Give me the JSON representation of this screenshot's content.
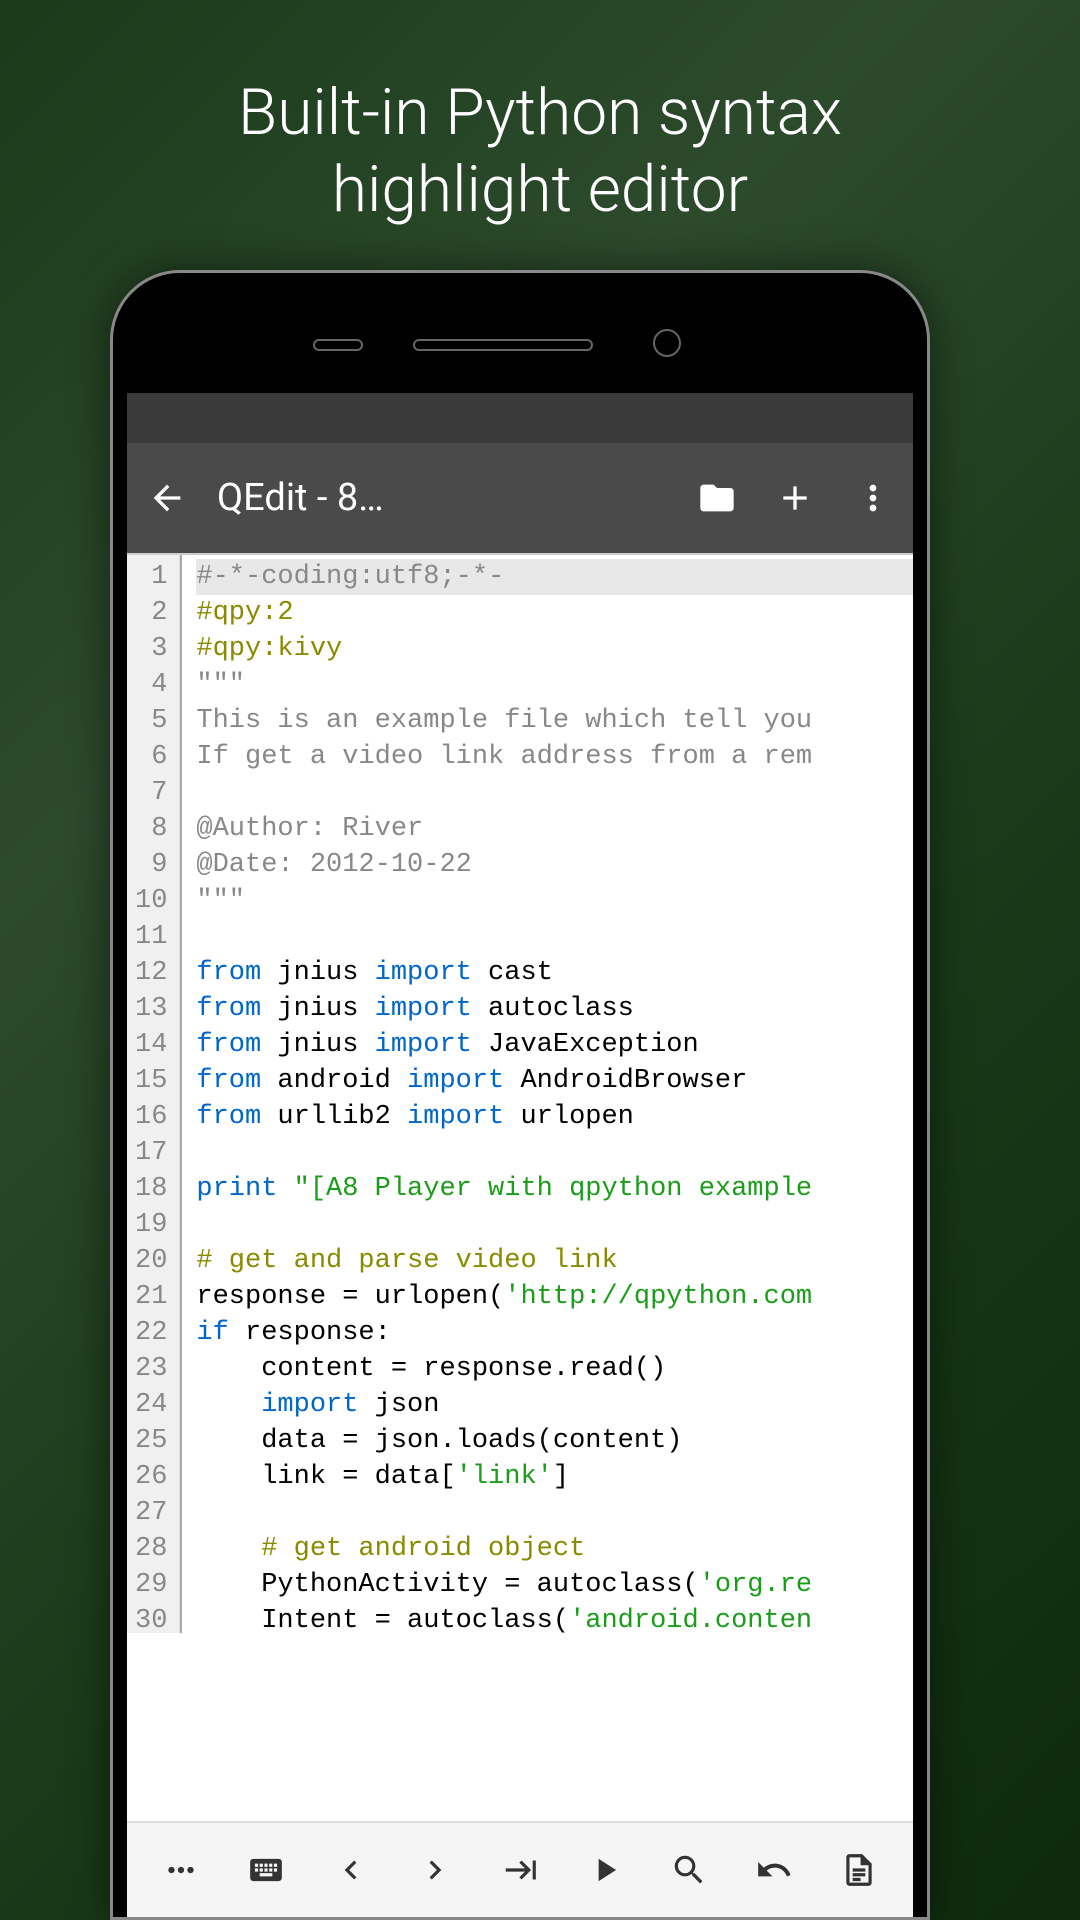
{
  "promo": {
    "line1": "Built-in Python syntax",
    "line2": "highlight editor"
  },
  "appbar": {
    "title": "QEdit - 8…"
  },
  "icons": {
    "back": "back-arrow",
    "folder": "folder",
    "add": "plus",
    "more": "more-vert",
    "menu": "dots",
    "keyboard": "keyboard",
    "left": "chevron-left",
    "right": "chevron-right",
    "tab": "tab-arrow",
    "play": "play",
    "search": "search",
    "undo": "undo",
    "doc": "document"
  },
  "code": {
    "line_count": 30,
    "lines": [
      {
        "n": 1,
        "hl": true,
        "tokens": [
          {
            "t": "#-*-coding:utf8;-*-",
            "c": "doc"
          }
        ]
      },
      {
        "n": 2,
        "tokens": [
          {
            "t": "#qpy:2",
            "c": "cmt"
          }
        ]
      },
      {
        "n": 3,
        "tokens": [
          {
            "t": "#qpy:kivy",
            "c": "cmt"
          }
        ]
      },
      {
        "n": 4,
        "tokens": [
          {
            "t": "\"\"\"",
            "c": "doc"
          }
        ]
      },
      {
        "n": 5,
        "tokens": [
          {
            "t": "This is an example file which tell you",
            "c": "doc"
          }
        ]
      },
      {
        "n": 6,
        "tokens": [
          {
            "t": "If get a video link address from a rem",
            "c": "doc"
          }
        ]
      },
      {
        "n": 7,
        "tokens": [
          {
            "t": "",
            "c": ""
          }
        ]
      },
      {
        "n": 8,
        "tokens": [
          {
            "t": "@Author: River",
            "c": "doc"
          }
        ]
      },
      {
        "n": 9,
        "tokens": [
          {
            "t": "@Date: 2012-10-22",
            "c": "doc"
          }
        ]
      },
      {
        "n": 10,
        "tokens": [
          {
            "t": "\"\"\"",
            "c": "doc"
          }
        ]
      },
      {
        "n": 11,
        "tokens": [
          {
            "t": "",
            "c": ""
          }
        ]
      },
      {
        "n": 12,
        "tokens": [
          {
            "t": "from",
            "c": "kw"
          },
          {
            "t": " jnius ",
            "c": ""
          },
          {
            "t": "import",
            "c": "kw"
          },
          {
            "t": " cast",
            "c": ""
          }
        ]
      },
      {
        "n": 13,
        "tokens": [
          {
            "t": "from",
            "c": "kw"
          },
          {
            "t": " jnius ",
            "c": ""
          },
          {
            "t": "import",
            "c": "kw"
          },
          {
            "t": " autoclass",
            "c": ""
          }
        ]
      },
      {
        "n": 14,
        "tokens": [
          {
            "t": "from",
            "c": "kw"
          },
          {
            "t": " jnius ",
            "c": ""
          },
          {
            "t": "import",
            "c": "kw"
          },
          {
            "t": " JavaException",
            "c": ""
          }
        ]
      },
      {
        "n": 15,
        "tokens": [
          {
            "t": "from",
            "c": "kw"
          },
          {
            "t": " android ",
            "c": ""
          },
          {
            "t": "import",
            "c": "kw"
          },
          {
            "t": " AndroidBrowser",
            "c": ""
          }
        ]
      },
      {
        "n": 16,
        "tokens": [
          {
            "t": "from",
            "c": "kw"
          },
          {
            "t": " urllib2 ",
            "c": ""
          },
          {
            "t": "import",
            "c": "kw"
          },
          {
            "t": " urlopen",
            "c": ""
          }
        ]
      },
      {
        "n": 17,
        "tokens": [
          {
            "t": "",
            "c": ""
          }
        ]
      },
      {
        "n": 18,
        "tokens": [
          {
            "t": "print",
            "c": "kw"
          },
          {
            "t": " ",
            "c": ""
          },
          {
            "t": "\"[A8 Player with qpython example",
            "c": "str"
          }
        ]
      },
      {
        "n": 19,
        "tokens": [
          {
            "t": "",
            "c": ""
          }
        ]
      },
      {
        "n": 20,
        "tokens": [
          {
            "t": "# get and parse video link",
            "c": "cmt"
          }
        ]
      },
      {
        "n": 21,
        "tokens": [
          {
            "t": "response = urlopen(",
            "c": ""
          },
          {
            "t": "'http://qpython.com",
            "c": "str"
          }
        ]
      },
      {
        "n": 22,
        "tokens": [
          {
            "t": "if",
            "c": "kw"
          },
          {
            "t": " response:",
            "c": ""
          }
        ]
      },
      {
        "n": 23,
        "tokens": [
          {
            "t": "    content = response.read()",
            "c": ""
          }
        ]
      },
      {
        "n": 24,
        "tokens": [
          {
            "t": "    ",
            "c": ""
          },
          {
            "t": "import",
            "c": "kw"
          },
          {
            "t": " json",
            "c": ""
          }
        ]
      },
      {
        "n": 25,
        "tokens": [
          {
            "t": "    data = json.loads(content)",
            "c": ""
          }
        ]
      },
      {
        "n": 26,
        "tokens": [
          {
            "t": "    link = data[",
            "c": ""
          },
          {
            "t": "'link'",
            "c": "str"
          },
          {
            "t": "]",
            "c": ""
          }
        ]
      },
      {
        "n": 27,
        "tokens": [
          {
            "t": "",
            "c": ""
          }
        ]
      },
      {
        "n": 28,
        "tokens": [
          {
            "t": "    ",
            "c": ""
          },
          {
            "t": "# get android object",
            "c": "cmt"
          }
        ]
      },
      {
        "n": 29,
        "tokens": [
          {
            "t": "    PythonActivity = autoclass(",
            "c": ""
          },
          {
            "t": "'org.re",
            "c": "str"
          }
        ]
      },
      {
        "n": 30,
        "tokens": [
          {
            "t": "    Intent = autoclass(",
            "c": ""
          },
          {
            "t": "'android.conten",
            "c": "str"
          }
        ]
      }
    ]
  }
}
